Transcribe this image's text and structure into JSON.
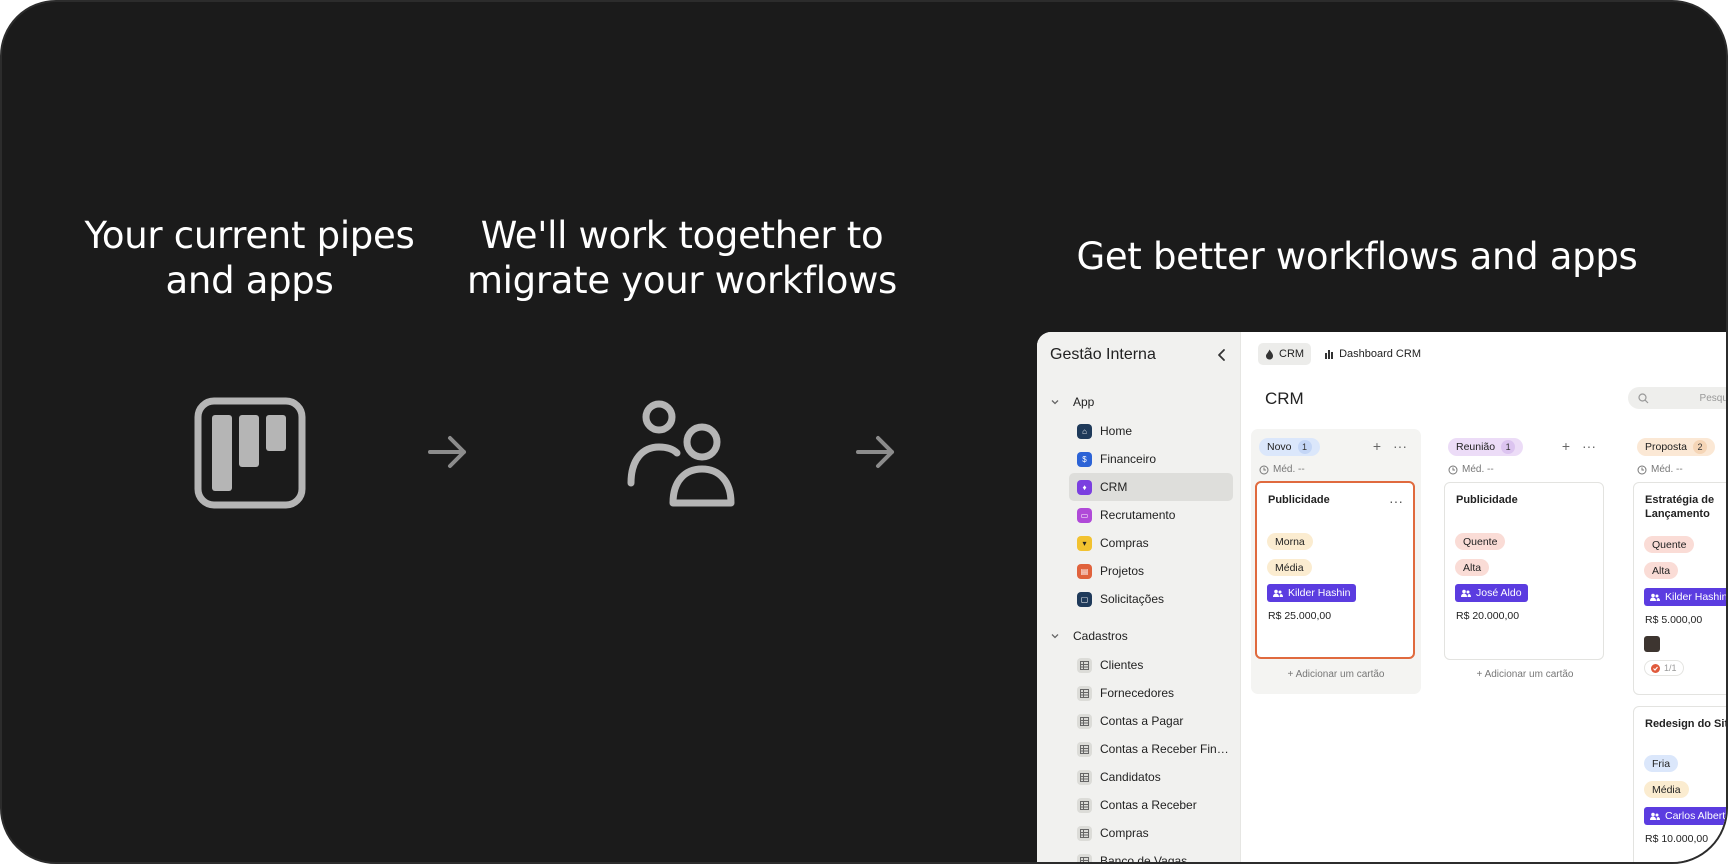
{
  "headings": {
    "current": "Your current pipes and apps",
    "migrate": "We'll work together to migrate your workflows",
    "better": "Get better workflows and apps"
  },
  "icons": {
    "board": "kanban-board-icon",
    "arrow": "arrow-right-icon",
    "users": "users-icon"
  },
  "colors": {
    "background": "#1b1b1b",
    "accent_person": "#5b3ce0",
    "selected_card_border": "#e06a3e"
  },
  "sidebar": {
    "title": "Gestão Interna",
    "sections": [
      {
        "label": "App",
        "items": [
          {
            "label": "Home",
            "color": "#1f3a5a"
          },
          {
            "label": "Financeiro",
            "color": "#2c63d6"
          },
          {
            "label": "CRM",
            "color": "#7b3fe0"
          },
          {
            "label": "Recrutamento",
            "color": "#b04ad8"
          },
          {
            "label": "Compras",
            "color": "#f2c230"
          },
          {
            "label": "Projetos",
            "color": "#e0623c"
          },
          {
            "label": "Solicitações",
            "color": "#1f3a5a"
          }
        ]
      },
      {
        "label": "Cadastros",
        "items": [
          {
            "label": "Clientes"
          },
          {
            "label": "Fornecedores"
          },
          {
            "label": "Contas a Pagar"
          },
          {
            "label": "Contas a Receber Fina..."
          },
          {
            "label": "Candidatos"
          },
          {
            "label": "Contas a Receber"
          },
          {
            "label": "Compras"
          },
          {
            "label": "Banco de Vagas"
          }
        ]
      }
    ]
  },
  "main": {
    "tabs": [
      {
        "label": "CRM"
      },
      {
        "label": "Dashboard CRM"
      }
    ],
    "title": "CRM",
    "search_placeholder": "Pesquisar",
    "columns": [
      {
        "label": "Novo",
        "count": "1",
        "color": "#dbe7fb",
        "meta": "Méd. --",
        "add_label": "+ Adicionar um cartão",
        "card": {
          "title": "Publicidade",
          "tag1": "Morna",
          "tag2": "Média",
          "person": "Kilder Hashin",
          "price": "R$ 25.000,00"
        }
      },
      {
        "label": "Reunião",
        "count": "1",
        "color": "#ecdcf7",
        "meta": "Méd. --",
        "add_label": "+ Adicionar um cartão",
        "card": {
          "title": "Publicidade",
          "tag1": "Quente",
          "tag2": "Alta",
          "person": "José Aldo",
          "price": "R$ 20.000,00"
        }
      },
      {
        "label": "Proposta",
        "count": "2",
        "color": "#fbe8d5",
        "meta": "Méd. --",
        "card": {
          "title": "Estratégia de Lançamento",
          "tag1": "Quente",
          "tag2": "Alta",
          "person": "Kilder Hashin",
          "price": "R$ 5.000,00",
          "checklist": "1/1"
        },
        "card2": {
          "title": "Redesign do Site",
          "tag1": "Fria",
          "tag2": "Média",
          "person": "Carlos Albert",
          "price": "R$ 10.000,00"
        }
      }
    ]
  }
}
